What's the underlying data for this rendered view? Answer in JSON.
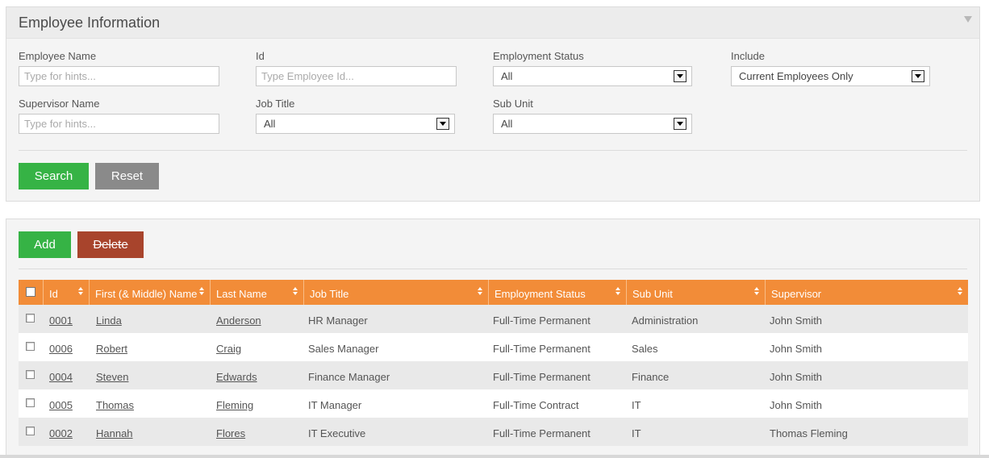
{
  "search_panel": {
    "title": "Employee Information",
    "employee_name": {
      "label": "Employee Name",
      "placeholder": "Type for hints..."
    },
    "id": {
      "label": "Id",
      "placeholder": "Type Employee Id..."
    },
    "employment_status": {
      "label": "Employment Status",
      "value": "All"
    },
    "include": {
      "label": "Include",
      "value": "Current Employees Only"
    },
    "supervisor_name": {
      "label": "Supervisor Name",
      "placeholder": "Type for hints..."
    },
    "job_title": {
      "label": "Job Title",
      "value": "All"
    },
    "sub_unit": {
      "label": "Sub Unit",
      "value": "All"
    },
    "search_label": "Search",
    "reset_label": "Reset"
  },
  "list_panel": {
    "add_label": "Add",
    "delete_label": "Delete",
    "columns": [
      "Id",
      "First (& Middle) Name",
      "Last Name",
      "Job Title",
      "Employment Status",
      "Sub Unit",
      "Supervisor"
    ],
    "rows": [
      {
        "id": "0001",
        "first": "Linda",
        "last": "Anderson",
        "job": "HR Manager",
        "status": "Full-Time Permanent",
        "unit": "Administration",
        "supervisor": "John Smith"
      },
      {
        "id": "0006",
        "first": "Robert",
        "last": "Craig",
        "job": "Sales Manager",
        "status": "Full-Time Permanent",
        "unit": "Sales",
        "supervisor": "John Smith"
      },
      {
        "id": "0004",
        "first": "Steven",
        "last": "Edwards",
        "job": "Finance Manager",
        "status": "Full-Time Permanent",
        "unit": "Finance",
        "supervisor": "John Smith"
      },
      {
        "id": "0005",
        "first": "Thomas",
        "last": "Fleming",
        "job": "IT Manager",
        "status": "Full-Time Contract",
        "unit": "IT",
        "supervisor": "John Smith"
      },
      {
        "id": "0002",
        "first": "Hannah",
        "last": "Flores",
        "job": "IT Executive",
        "status": "Full-Time Permanent",
        "unit": "IT",
        "supervisor": "Thomas Fleming"
      }
    ]
  },
  "colors": {
    "accent_orange": "#f28c38",
    "button_green": "#36b345",
    "button_gray": "#8a8a8a",
    "button_red": "#a8442c"
  },
  "icons": {
    "panel_toggle": "triangle-down-icon",
    "select_arrow": "dropdown-arrow-icon",
    "sort": "sort-icon"
  }
}
